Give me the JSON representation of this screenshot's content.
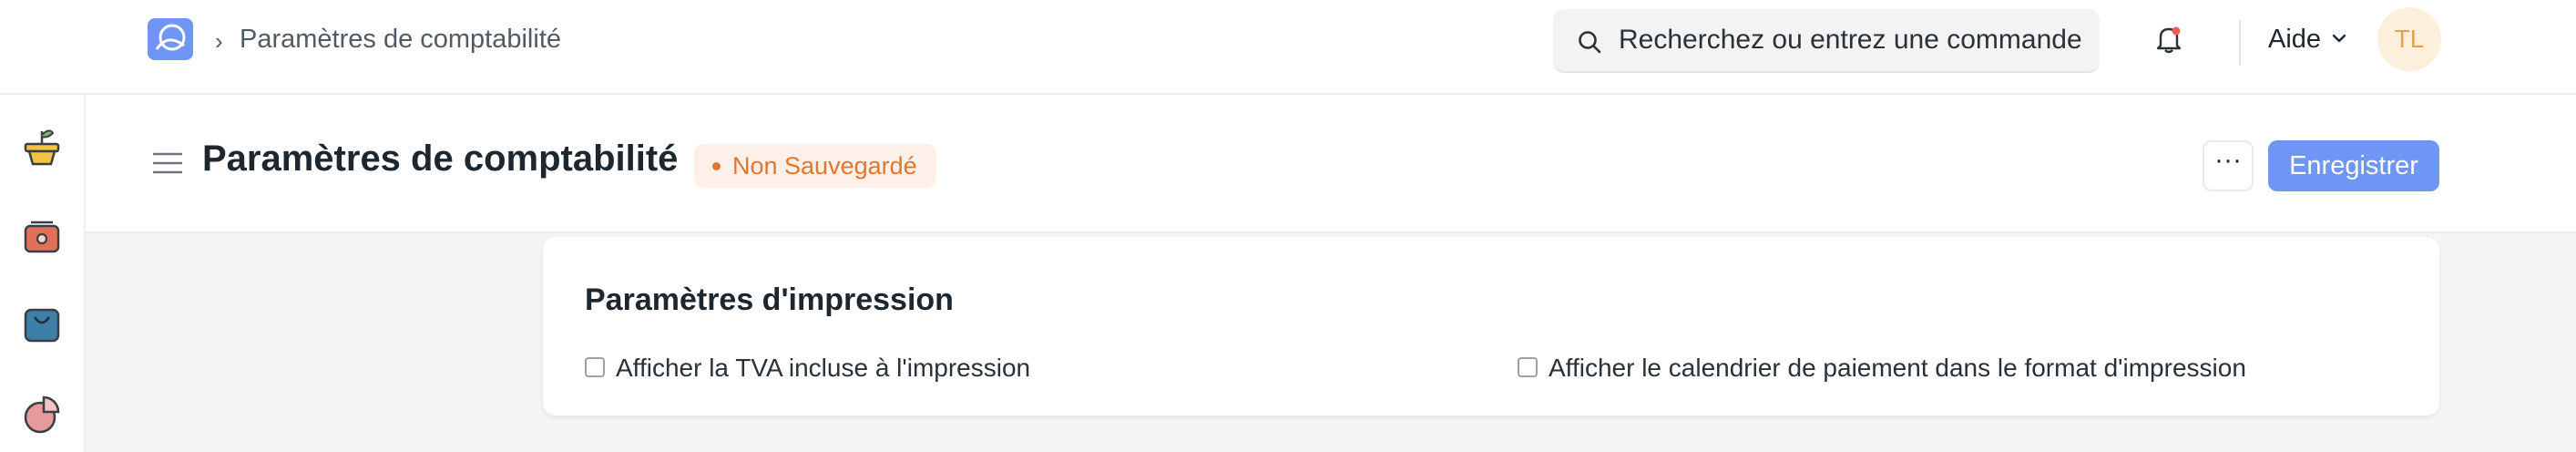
{
  "navbar": {
    "breadcrumb": "Paramètres de comptabilité",
    "search_placeholder": "Recherchez ou entrez une commande",
    "help_label": "Aide",
    "avatar_initials": "TL"
  },
  "sidebar": {
    "items": [
      {
        "icon": "plant-pot-icon"
      },
      {
        "icon": "safe-box-icon"
      },
      {
        "icon": "shopping-bag-icon"
      },
      {
        "icon": "pie-chart-icon"
      }
    ]
  },
  "page_header": {
    "title": "Paramètres de comptabilité",
    "status_badge": "Non Sauvegardé",
    "more_label": "···",
    "save_label": "Enregistrer"
  },
  "section": {
    "title": "Paramètres d'impression",
    "fields": [
      {
        "label": "Afficher la TVA incluse à l'impression",
        "checked": false
      },
      {
        "label": "Afficher le calendrier de paiement dans le format d'impression",
        "checked": false
      }
    ]
  },
  "colors": {
    "primary": "#6f95f5",
    "badge_text": "#e0772f",
    "badge_bg": "#fdf0e9",
    "avatar_bg": "#fcefdb",
    "avatar_text": "#e3a34c"
  }
}
